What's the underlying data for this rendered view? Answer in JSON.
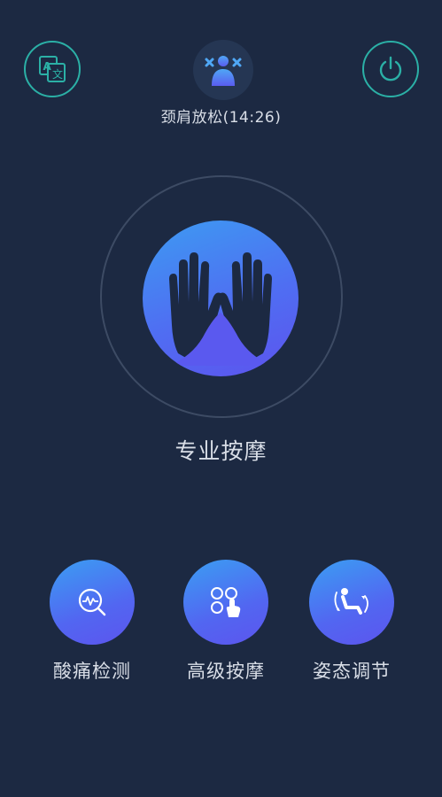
{
  "header": {
    "language_icon": "translate-icon",
    "power_icon": "power-icon",
    "mode_icon": "person-stretch-icon",
    "mode_label": "颈肩放松(14:26)"
  },
  "main": {
    "icon": "hands-icon",
    "label": "专业按摩"
  },
  "features": [
    {
      "label": "酸痛检测",
      "icon": "pain-detect-icon"
    },
    {
      "label": "高级按摩",
      "icon": "touch-grid-icon"
    },
    {
      "label": "姿态调节",
      "icon": "recline-posture-icon"
    }
  ],
  "colors": {
    "background": "#1c2942",
    "accent_teal": "#2bb0a6",
    "gradient_start": "#3d9bf2",
    "gradient_end": "#5d53ee"
  }
}
